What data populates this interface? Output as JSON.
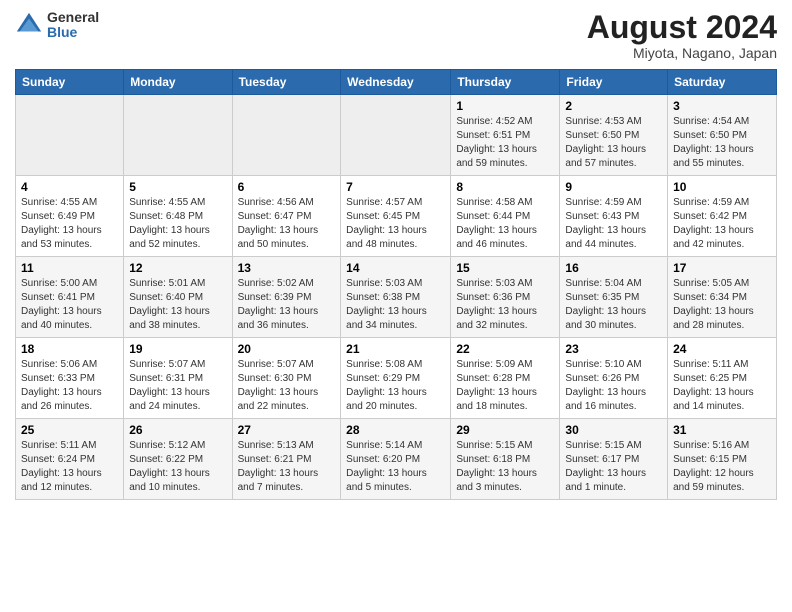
{
  "header": {
    "logo": {
      "general": "General",
      "blue": "Blue"
    },
    "title": "August 2024",
    "location": "Miyota, Nagano, Japan"
  },
  "days_of_week": [
    "Sunday",
    "Monday",
    "Tuesday",
    "Wednesday",
    "Thursday",
    "Friday",
    "Saturday"
  ],
  "weeks": [
    [
      {
        "day": "",
        "info": ""
      },
      {
        "day": "",
        "info": ""
      },
      {
        "day": "",
        "info": ""
      },
      {
        "day": "",
        "info": ""
      },
      {
        "day": "1",
        "info": "Sunrise: 4:52 AM\nSunset: 6:51 PM\nDaylight: 13 hours\nand 59 minutes."
      },
      {
        "day": "2",
        "info": "Sunrise: 4:53 AM\nSunset: 6:50 PM\nDaylight: 13 hours\nand 57 minutes."
      },
      {
        "day": "3",
        "info": "Sunrise: 4:54 AM\nSunset: 6:50 PM\nDaylight: 13 hours\nand 55 minutes."
      }
    ],
    [
      {
        "day": "4",
        "info": "Sunrise: 4:55 AM\nSunset: 6:49 PM\nDaylight: 13 hours\nand 53 minutes."
      },
      {
        "day": "5",
        "info": "Sunrise: 4:55 AM\nSunset: 6:48 PM\nDaylight: 13 hours\nand 52 minutes."
      },
      {
        "day": "6",
        "info": "Sunrise: 4:56 AM\nSunset: 6:47 PM\nDaylight: 13 hours\nand 50 minutes."
      },
      {
        "day": "7",
        "info": "Sunrise: 4:57 AM\nSunset: 6:45 PM\nDaylight: 13 hours\nand 48 minutes."
      },
      {
        "day": "8",
        "info": "Sunrise: 4:58 AM\nSunset: 6:44 PM\nDaylight: 13 hours\nand 46 minutes."
      },
      {
        "day": "9",
        "info": "Sunrise: 4:59 AM\nSunset: 6:43 PM\nDaylight: 13 hours\nand 44 minutes."
      },
      {
        "day": "10",
        "info": "Sunrise: 4:59 AM\nSunset: 6:42 PM\nDaylight: 13 hours\nand 42 minutes."
      }
    ],
    [
      {
        "day": "11",
        "info": "Sunrise: 5:00 AM\nSunset: 6:41 PM\nDaylight: 13 hours\nand 40 minutes."
      },
      {
        "day": "12",
        "info": "Sunrise: 5:01 AM\nSunset: 6:40 PM\nDaylight: 13 hours\nand 38 minutes."
      },
      {
        "day": "13",
        "info": "Sunrise: 5:02 AM\nSunset: 6:39 PM\nDaylight: 13 hours\nand 36 minutes."
      },
      {
        "day": "14",
        "info": "Sunrise: 5:03 AM\nSunset: 6:38 PM\nDaylight: 13 hours\nand 34 minutes."
      },
      {
        "day": "15",
        "info": "Sunrise: 5:03 AM\nSunset: 6:36 PM\nDaylight: 13 hours\nand 32 minutes."
      },
      {
        "day": "16",
        "info": "Sunrise: 5:04 AM\nSunset: 6:35 PM\nDaylight: 13 hours\nand 30 minutes."
      },
      {
        "day": "17",
        "info": "Sunrise: 5:05 AM\nSunset: 6:34 PM\nDaylight: 13 hours\nand 28 minutes."
      }
    ],
    [
      {
        "day": "18",
        "info": "Sunrise: 5:06 AM\nSunset: 6:33 PM\nDaylight: 13 hours\nand 26 minutes."
      },
      {
        "day": "19",
        "info": "Sunrise: 5:07 AM\nSunset: 6:31 PM\nDaylight: 13 hours\nand 24 minutes."
      },
      {
        "day": "20",
        "info": "Sunrise: 5:07 AM\nSunset: 6:30 PM\nDaylight: 13 hours\nand 22 minutes."
      },
      {
        "day": "21",
        "info": "Sunrise: 5:08 AM\nSunset: 6:29 PM\nDaylight: 13 hours\nand 20 minutes."
      },
      {
        "day": "22",
        "info": "Sunrise: 5:09 AM\nSunset: 6:28 PM\nDaylight: 13 hours\nand 18 minutes."
      },
      {
        "day": "23",
        "info": "Sunrise: 5:10 AM\nSunset: 6:26 PM\nDaylight: 13 hours\nand 16 minutes."
      },
      {
        "day": "24",
        "info": "Sunrise: 5:11 AM\nSunset: 6:25 PM\nDaylight: 13 hours\nand 14 minutes."
      }
    ],
    [
      {
        "day": "25",
        "info": "Sunrise: 5:11 AM\nSunset: 6:24 PM\nDaylight: 13 hours\nand 12 minutes."
      },
      {
        "day": "26",
        "info": "Sunrise: 5:12 AM\nSunset: 6:22 PM\nDaylight: 13 hours\nand 10 minutes."
      },
      {
        "day": "27",
        "info": "Sunrise: 5:13 AM\nSunset: 6:21 PM\nDaylight: 13 hours\nand 7 minutes."
      },
      {
        "day": "28",
        "info": "Sunrise: 5:14 AM\nSunset: 6:20 PM\nDaylight: 13 hours\nand 5 minutes."
      },
      {
        "day": "29",
        "info": "Sunrise: 5:15 AM\nSunset: 6:18 PM\nDaylight: 13 hours\nand 3 minutes."
      },
      {
        "day": "30",
        "info": "Sunrise: 5:15 AM\nSunset: 6:17 PM\nDaylight: 13 hours\nand 1 minute."
      },
      {
        "day": "31",
        "info": "Sunrise: 5:16 AM\nSunset: 6:15 PM\nDaylight: 12 hours\nand 59 minutes."
      }
    ]
  ]
}
